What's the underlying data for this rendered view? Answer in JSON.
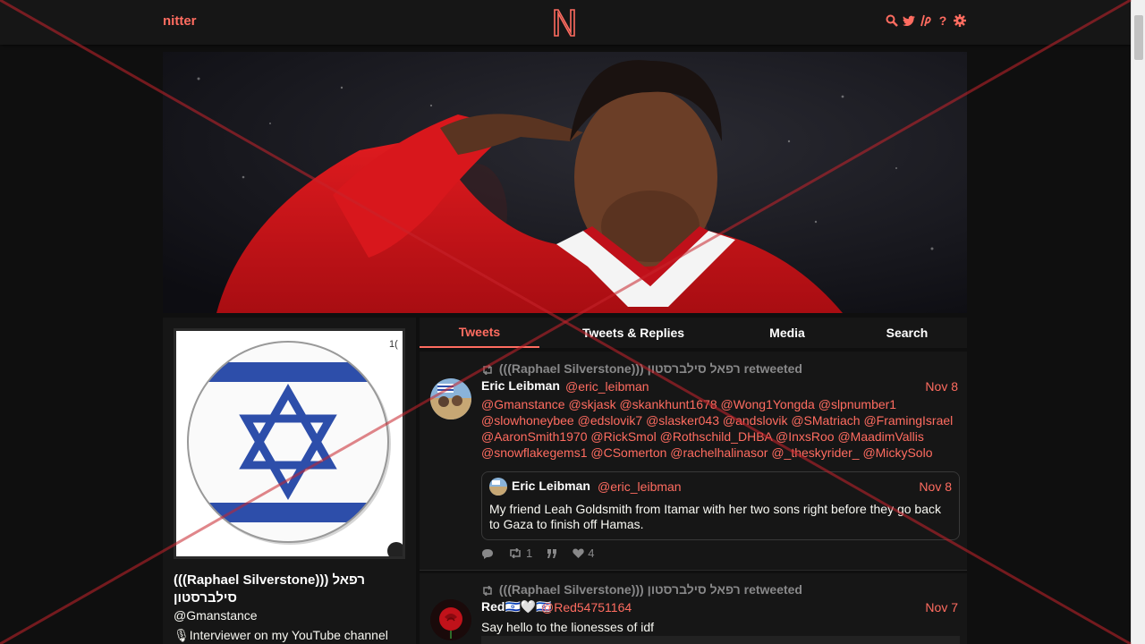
{
  "nav": {
    "brand": "nitter",
    "logo_letter": "N",
    "icons": [
      "search-icon",
      "twitter-bird-icon",
      "lp-icon",
      "help-icon",
      "gear-icon"
    ]
  },
  "profile": {
    "name": "(((Raphael Silverstone))) רפאל סילברסטון",
    "handle": "@Gmanstance",
    "bio": "🎙Interviewer on my YouTube channel",
    "avatar_badge": "1("
  },
  "tabs": [
    {
      "label": "Tweets",
      "active": true
    },
    {
      "label": "Tweets & Replies",
      "active": false
    },
    {
      "label": "Media",
      "active": false
    },
    {
      "label": "Search",
      "active": false
    }
  ],
  "tweets": [
    {
      "retweet_header": "(((Raphael Silverstone))) רפאל סילברסטון retweeted",
      "fullname": "Eric Leibman",
      "username": "@eric_leibman",
      "date": "Nov 8",
      "body_lines": [
        "@Gmanstance @skjask @skankhunt1678 @Wong1Yongda @slpnumber1",
        "@slowhoneybee @edslovik7 @slasker043 @andslovik @SMatriach @FramingIsrael",
        "@AaronSmith1970 @RickSmol @Rothschild_DHBA @InxsRoo @MaadimVallis",
        "@snowflakegems1 @CSomerton @rachelhalinasor @_theskyrider_ @MickySolo"
      ],
      "quote": {
        "fullname": "Eric Leibman",
        "username": "@eric_leibman",
        "date": "Nov 8",
        "text": "My friend Leah Goldsmith from Itamar with her two sons right before they go back to Gaza to finish off Hamas."
      },
      "stats": {
        "replies": "",
        "retweets": "1",
        "quotes": "",
        "likes": "4"
      }
    },
    {
      "retweet_header": "(((Raphael Silverstone))) רפאל סילברסטון retweeted",
      "fullname": "Red🇮🇱🤍🇮🇱",
      "username": "@Red54751164",
      "date": "Nov 7",
      "body": "Say hello to the lionesses of idf"
    }
  ],
  "colors": {
    "accent": "#ff6c60",
    "bg": "#0f0f0f",
    "panel": "#161616",
    "israel_blue": "#2d4eaa"
  }
}
